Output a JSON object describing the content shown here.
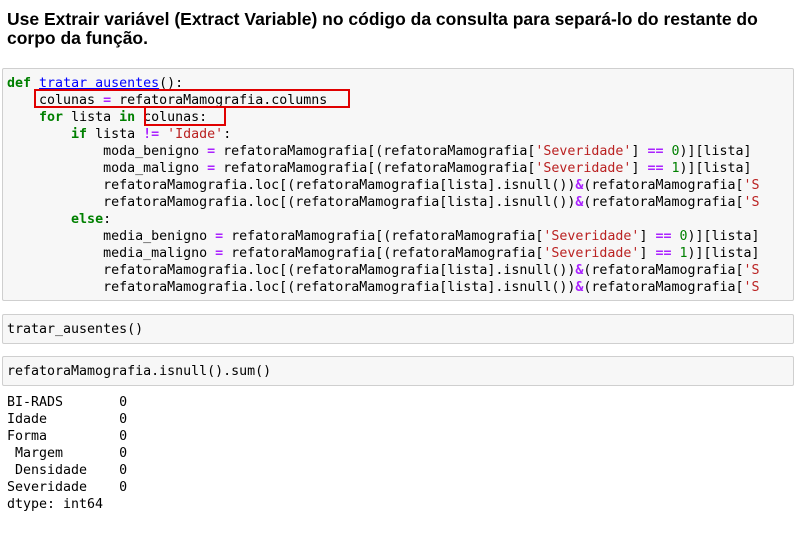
{
  "heading": "Use Extrair variável (Extract Variable) no código da consulta para separá-lo do restante do corpo da função.",
  "cell1": {
    "lines": [
      [
        {
          "t": "def",
          "c": "kw"
        },
        {
          "t": " "
        },
        {
          "t": "tratar_ausentes",
          "c": "fn"
        },
        {
          "t": "():"
        }
      ],
      [
        {
          "t": "    colunas "
        },
        {
          "t": "=",
          "c": "op"
        },
        {
          "t": " refatoraMamografia.columns"
        }
      ],
      [
        {
          "t": "    "
        },
        {
          "t": "for",
          "c": "kw"
        },
        {
          "t": " lista "
        },
        {
          "t": "in",
          "c": "kw"
        },
        {
          "t": " colunas:"
        }
      ],
      [
        {
          "t": "        "
        },
        {
          "t": "if",
          "c": "kw"
        },
        {
          "t": " lista "
        },
        {
          "t": "!=",
          "c": "op"
        },
        {
          "t": " "
        },
        {
          "t": "'Idade'",
          "c": "str"
        },
        {
          "t": ":"
        }
      ],
      [
        {
          "t": "            moda_benigno "
        },
        {
          "t": "=",
          "c": "op"
        },
        {
          "t": " refatoraMamografia[(refatoraMamografia["
        },
        {
          "t": "'Severidade'",
          "c": "str"
        },
        {
          "t": "] "
        },
        {
          "t": "==",
          "c": "op"
        },
        {
          "t": " "
        },
        {
          "t": "0",
          "c": "num"
        },
        {
          "t": ")][lista]"
        }
      ],
      [
        {
          "t": "            moda_maligno "
        },
        {
          "t": "=",
          "c": "op"
        },
        {
          "t": " refatoraMamografia[(refatoraMamografia["
        },
        {
          "t": "'Severidade'",
          "c": "str"
        },
        {
          "t": "] "
        },
        {
          "t": "==",
          "c": "op"
        },
        {
          "t": " "
        },
        {
          "t": "1",
          "c": "num"
        },
        {
          "t": ")][lista]"
        }
      ],
      [
        {
          "t": "            refatoraMamografia.loc[(refatoraMamografia[lista].isnull())"
        },
        {
          "t": "&",
          "c": "op"
        },
        {
          "t": "(refatoraMamografia["
        },
        {
          "t": "'S",
          "c": "str"
        }
      ],
      [
        {
          "t": "            refatoraMamografia.loc[(refatoraMamografia[lista].isnull())"
        },
        {
          "t": "&",
          "c": "op"
        },
        {
          "t": "(refatoraMamografia["
        },
        {
          "t": "'S",
          "c": "str"
        }
      ],
      [
        {
          "t": "        "
        },
        {
          "t": "else",
          "c": "kw"
        },
        {
          "t": ":"
        }
      ],
      [
        {
          "t": "            media_benigno "
        },
        {
          "t": "=",
          "c": "op"
        },
        {
          "t": " refatoraMamografia[(refatoraMamografia["
        },
        {
          "t": "'Severidade'",
          "c": "str"
        },
        {
          "t": "] "
        },
        {
          "t": "==",
          "c": "op"
        },
        {
          "t": " "
        },
        {
          "t": "0",
          "c": "num"
        },
        {
          "t": ")][lista]"
        }
      ],
      [
        {
          "t": "            media_maligno "
        },
        {
          "t": "=",
          "c": "op"
        },
        {
          "t": " refatoraMamografia[(refatoraMamografia["
        },
        {
          "t": "'Severidade'",
          "c": "str"
        },
        {
          "t": "] "
        },
        {
          "t": "==",
          "c": "op"
        },
        {
          "t": " "
        },
        {
          "t": "1",
          "c": "num"
        },
        {
          "t": ")][lista]"
        }
      ],
      [
        {
          "t": "            refatoraMamografia.loc[(refatoraMamografia[lista].isnull())"
        },
        {
          "t": "&",
          "c": "op"
        },
        {
          "t": "(refatoraMamografia["
        },
        {
          "t": "'S",
          "c": "str"
        }
      ],
      [
        {
          "t": "            refatoraMamografia.loc[(refatoraMamografia[lista].isnull())"
        },
        {
          "t": "&",
          "c": "op"
        },
        {
          "t": "(refatoraMamografia["
        },
        {
          "t": "'S",
          "c": "str"
        }
      ]
    ]
  },
  "cell2": {
    "code": "tratar_ausentes()"
  },
  "cell3": {
    "code": "refatoraMamografia.isnull().sum()"
  },
  "output": [
    "BI-RADS       0",
    "Idade         0",
    "Forma         0",
    " Margem       0",
    " Densidade    0",
    "Severidade    0",
    "dtype: int64"
  ],
  "highlight_color": "#e00000"
}
